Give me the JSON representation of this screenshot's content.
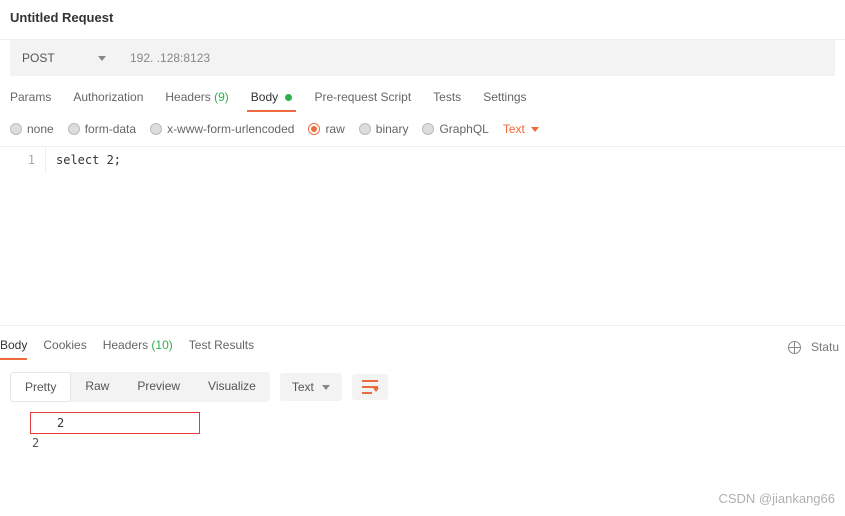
{
  "request_title": "Untitled Request",
  "method": "POST",
  "url": "192. .128:8123",
  "req_tabs": {
    "params": "Params",
    "authorization": "Authorization",
    "headers_label": "Headers",
    "headers_count": "(9)",
    "body": "Body",
    "prerequest": "Pre-request Script",
    "tests": "Tests",
    "settings": "Settings"
  },
  "body_types": {
    "none": "none",
    "formdata": "form-data",
    "xwww": "x-www-form-urlencoded",
    "raw": "raw",
    "binary": "binary",
    "graphql": "GraphQL",
    "text_dd": "Text"
  },
  "editor": {
    "line_num": "1",
    "code": "select 2;"
  },
  "resp_tabs": {
    "body": "Body",
    "cookies": "Cookies",
    "headers_label": "Headers",
    "headers_count": "(10)",
    "test_results": "Test Results",
    "status": "Statu"
  },
  "view_modes": {
    "pretty": "Pretty",
    "raw": "Raw",
    "preview": "Preview",
    "visualize": "Visualize",
    "lang": "Text"
  },
  "result": {
    "value": "2",
    "overflow": "2"
  },
  "watermark": "CSDN @jiankang66"
}
